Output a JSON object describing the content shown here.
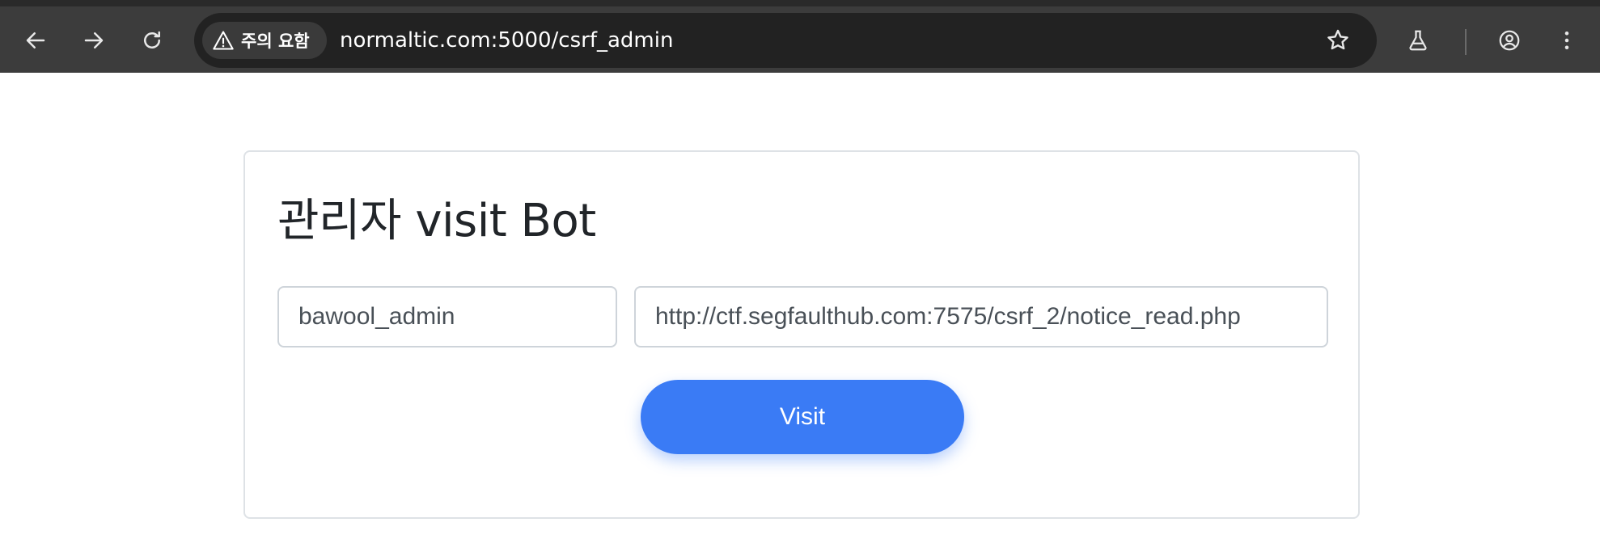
{
  "browser": {
    "security_chip_label": "주의 요함",
    "url": "normaltic.com:5000/csrf_admin",
    "icons": [
      "back-arrow-icon",
      "forward-arrow-icon",
      "reload-icon",
      "warning-triangle-icon",
      "star-icon",
      "flask-icon",
      "account-icon",
      "more-vert-icon"
    ]
  },
  "page": {
    "title": "관리자 visit Bot",
    "id_field_value": "bawool_admin",
    "url_field_value": "http://ctf.segfaulthub.com:7575/csrf_2/notice_read.php",
    "visit_button_label": "Visit"
  },
  "colors": {
    "toolbar_bg": "#3c3c3c",
    "omnibox_bg": "#222222",
    "button_blue": "#3a7bf5",
    "title_text": "#212529"
  }
}
